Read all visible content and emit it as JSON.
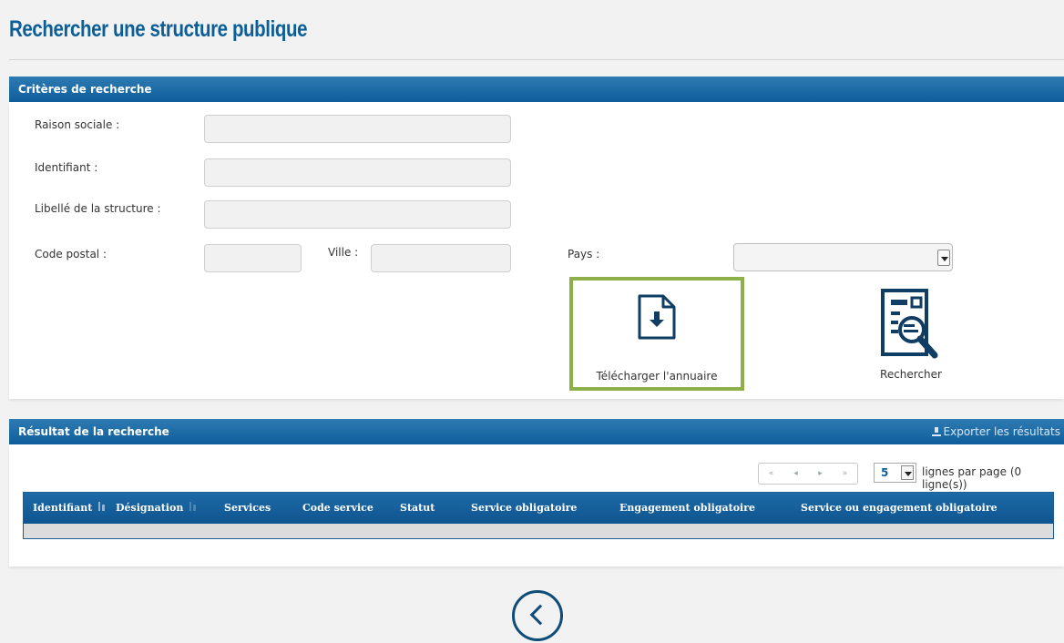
{
  "page": {
    "title": "Rechercher une structure publique"
  },
  "criteria": {
    "header": "Critères de recherche",
    "raison_sociale": {
      "label": "Raison sociale :",
      "value": ""
    },
    "identifiant": {
      "label": "Identifiant :",
      "value": ""
    },
    "libelle": {
      "label": "Libellé de la structure :",
      "value": ""
    },
    "code_postal": {
      "label": "Code postal :",
      "value": ""
    },
    "ville": {
      "label": "Ville :",
      "value": ""
    },
    "pays": {
      "label": "Pays :",
      "selected": ""
    },
    "download_label": "Télécharger l'annuaire",
    "search_label": "Rechercher"
  },
  "results": {
    "header": "Résultat de la recherche",
    "export_label": "Exporter les résultats",
    "pager": {
      "first": "«",
      "prev": "◂",
      "next": "▸",
      "last": "»"
    },
    "rows_per_page": "5",
    "rows_text": "lignes par page (0 ligne(s))",
    "columns": [
      "Identifiant",
      "Désignation",
      "Services",
      "Code service",
      "Statut",
      "Service obligatoire",
      "Engagement obligatoire",
      "Service ou engagement obligatoire"
    ]
  },
  "colors": {
    "brand": "#0c5e96",
    "highlight": "#8db04a",
    "bar": "#0e5e9b"
  }
}
